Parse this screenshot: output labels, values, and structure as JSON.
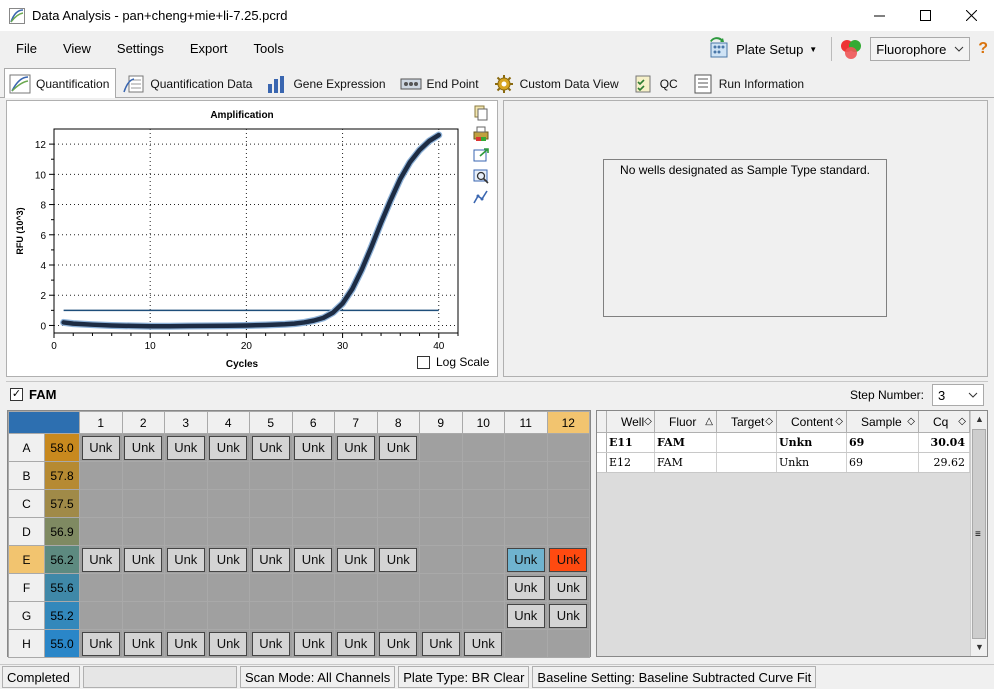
{
  "window": {
    "title": "Data Analysis - pan+cheng+mie+li-7.25.pcrd"
  },
  "menu": [
    "File",
    "View",
    "Settings",
    "Export",
    "Tools"
  ],
  "toolbar": {
    "plate_setup": "Plate Setup",
    "fluorophore": "Fluorophore"
  },
  "tabs": [
    "Quantification",
    "Quantification Data",
    "Gene Expression",
    "End Point",
    "Custom Data View",
    "QC",
    "Run Information"
  ],
  "active_tab": "Quantification",
  "chart": {
    "title": "Amplification",
    "xlabel": "Cycles",
    "ylabel": "RFU (10^3)",
    "log_scale_label": "Log Scale"
  },
  "chart_data": {
    "type": "line",
    "title": "Amplification",
    "xlabel": "Cycles",
    "ylabel": "RFU (10^3)",
    "xlim": [
      0,
      42
    ],
    "ylim": [
      -0.5,
      13.0
    ],
    "xticks": [
      0,
      10,
      20,
      30,
      40
    ],
    "yticks": [
      0,
      2,
      4,
      6,
      8,
      10,
      12
    ],
    "grid": true,
    "threshold": 1.0,
    "series": [
      {
        "color": "#1d2c44",
        "x": [
          1,
          2,
          4,
          6,
          8,
          10,
          12,
          14,
          16,
          18,
          20,
          22,
          24,
          25,
          26,
          27,
          28,
          29,
          30,
          31,
          32,
          33,
          34,
          35,
          36,
          37,
          38,
          39,
          40
        ],
        "y": [
          0.2,
          0.12,
          0.05,
          0.0,
          -0.03,
          -0.05,
          -0.05,
          -0.04,
          -0.03,
          -0.02,
          0.0,
          0.03,
          0.08,
          0.12,
          0.2,
          0.32,
          0.5,
          0.85,
          1.45,
          2.4,
          3.7,
          5.2,
          6.8,
          8.3,
          9.7,
          10.8,
          11.6,
          12.2,
          12.6
        ]
      }
    ]
  },
  "std_curve": {
    "message": "No wells designated as Sample Type standard."
  },
  "fam": {
    "label": "FAM",
    "checked": true,
    "step_label": "Step Number:",
    "step_value": "3"
  },
  "plate": {
    "columns": [
      "1",
      "2",
      "3",
      "4",
      "5",
      "6",
      "7",
      "8",
      "9",
      "10",
      "11",
      "12"
    ],
    "rows": [
      {
        "label": "A",
        "temp": "58.0",
        "color": "#c8891e",
        "wells": [
          "Unk",
          "Unk",
          "Unk",
          "Unk",
          "Unk",
          "Unk",
          "Unk",
          "Unk",
          "",
          "",
          "",
          ""
        ]
      },
      {
        "label": "B",
        "temp": "57.8",
        "color": "#b68a32",
        "wells": [
          "",
          "",
          "",
          "",
          "",
          "",
          "",
          "",
          "",
          "",
          "",
          ""
        ]
      },
      {
        "label": "C",
        "temp": "57.5",
        "color": "#a08a48",
        "wells": [
          "",
          "",
          "",
          "",
          "",
          "",
          "",
          "",
          "",
          "",
          "",
          ""
        ]
      },
      {
        "label": "D",
        "temp": "56.9",
        "color": "#7f8a62",
        "wells": [
          "",
          "",
          "",
          "",
          "",
          "",
          "",
          "",
          "",
          "",
          "",
          ""
        ]
      },
      {
        "label": "E",
        "temp": "56.2",
        "color": "#5d8a80",
        "wells": [
          "Unk",
          "Unk",
          "Unk",
          "Unk",
          "Unk",
          "Unk",
          "Unk",
          "Unk",
          "",
          "",
          "Unk",
          "Unk"
        ]
      },
      {
        "label": "F",
        "temp": "55.6",
        "color": "#3f88a8",
        "wells": [
          "",
          "",
          "",
          "",
          "",
          "",
          "",
          "",
          "",
          "",
          "Unk",
          "Unk"
        ]
      },
      {
        "label": "G",
        "temp": "55.2",
        "color": "#3388bb",
        "wells": [
          "",
          "",
          "",
          "",
          "",
          "",
          "",
          "",
          "",
          "",
          "Unk",
          "Unk"
        ]
      },
      {
        "label": "H",
        "temp": "55.0",
        "color": "#2a86c8",
        "wells": [
          "Unk",
          "Unk",
          "Unk",
          "Unk",
          "Unk",
          "Unk",
          "Unk",
          "Unk",
          "Unk",
          "Unk",
          "",
          ""
        ]
      }
    ]
  },
  "results": {
    "headers": [
      "Well",
      "Fluor",
      "Target",
      "Content",
      "Sample",
      "Cq"
    ],
    "rows": [
      {
        "well": "E11",
        "fluor": "FAM",
        "target": "",
        "content": "Unkn",
        "sample": "69",
        "cq": "30.04",
        "bold": true
      },
      {
        "well": "E12",
        "fluor": "FAM",
        "target": "",
        "content": "Unkn",
        "sample": "69",
        "cq": "29.62",
        "bold": false
      }
    ]
  },
  "status": {
    "state": "Completed",
    "scan_mode": "Scan Mode: All Channels",
    "plate_type": "Plate Type: BR Clear",
    "baseline": "Baseline Setting: Baseline Subtracted Curve Fit"
  }
}
